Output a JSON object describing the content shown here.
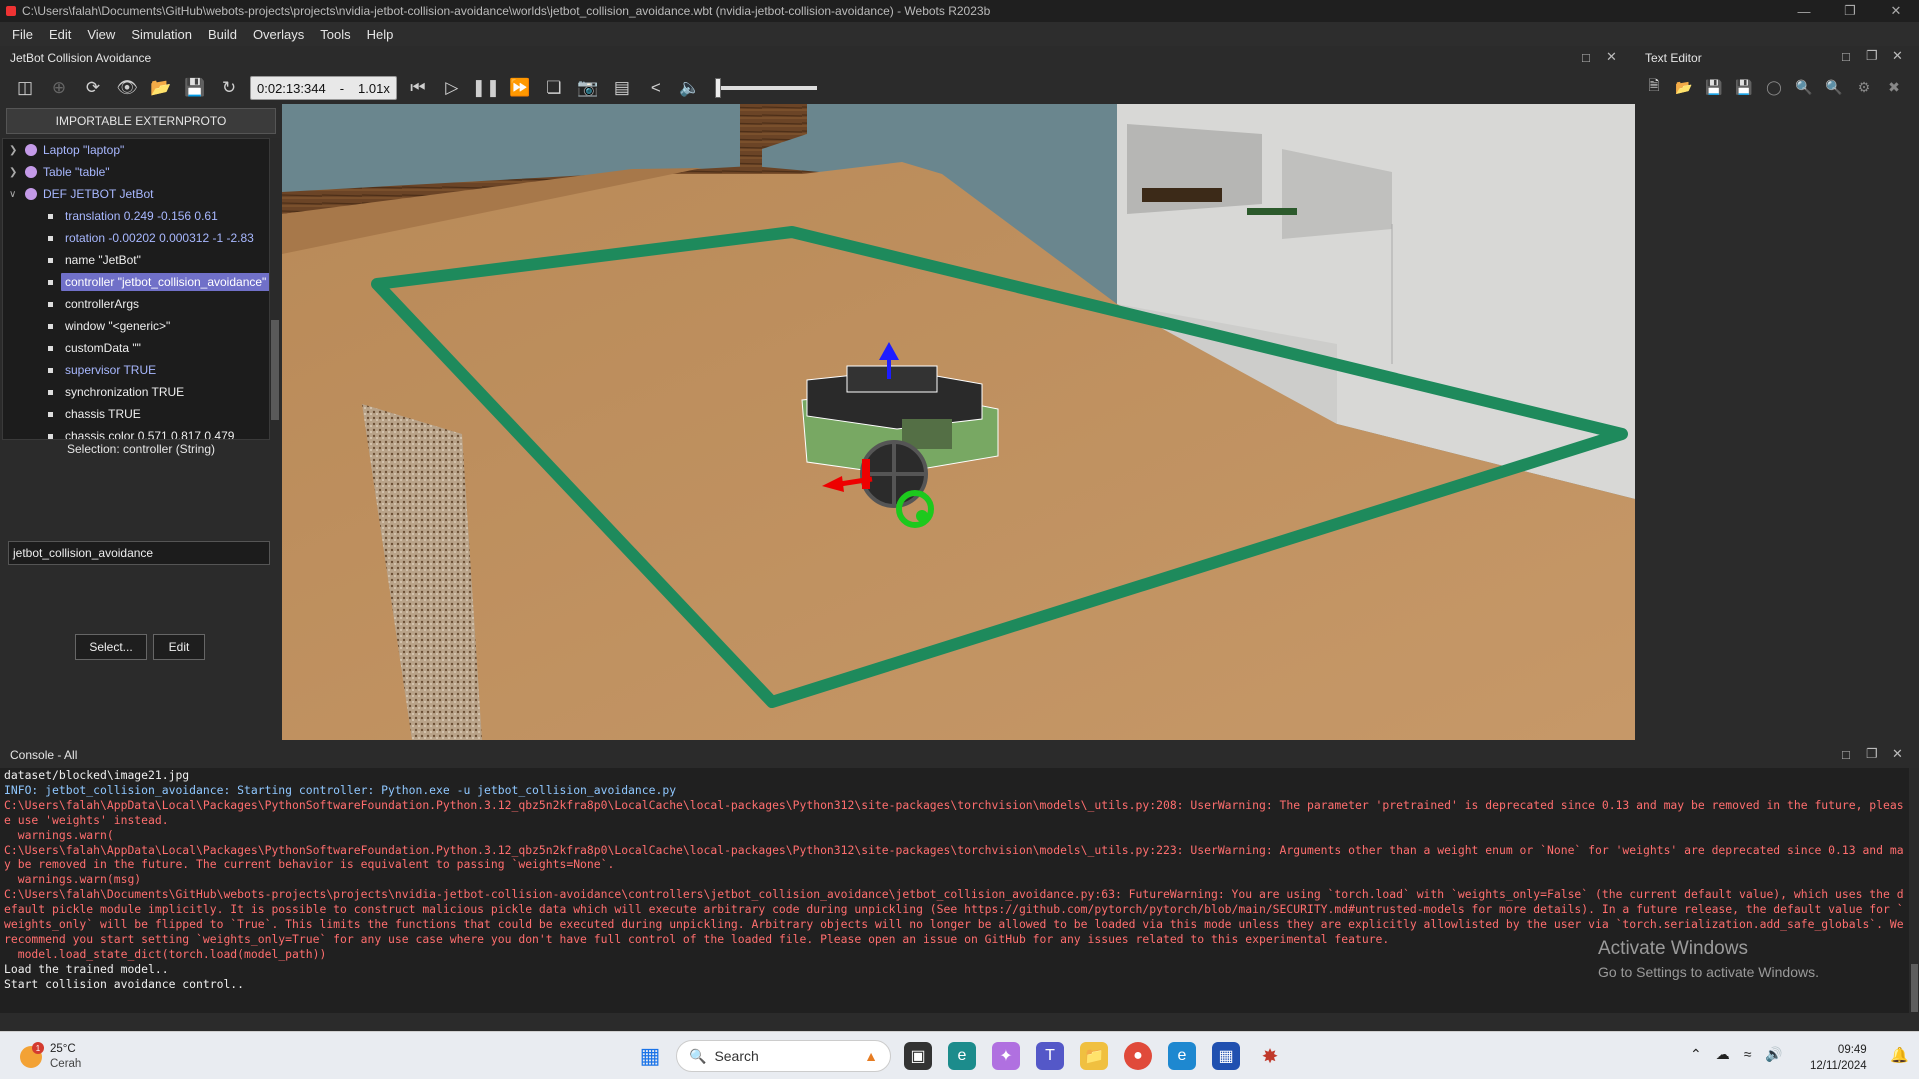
{
  "window": {
    "title": "C:\\Users\\falah\\Documents\\GitHub\\webots-projects\\projects\\nvidia-jetbot-collision-avoidance\\worlds\\jetbot_collision_avoidance.wbt (nvidia-jetbot-collision-avoidance) - Webots R2023b"
  },
  "menu": [
    "File",
    "Edit",
    "View",
    "Simulation",
    "Build",
    "Overlays",
    "Tools",
    "Help"
  ],
  "scene_panel": {
    "title": "JetBot Collision Avoidance",
    "import_button": "IMPORTABLE EXTERNPROTO",
    "tree": [
      {
        "label": "Laptop \"laptop\"",
        "type": "node"
      },
      {
        "label": "Table \"table\"",
        "type": "node"
      },
      {
        "label": "DEF JETBOT JetBot",
        "type": "node",
        "expanded": true
      },
      {
        "label": "translation 0.249 -0.156 0.61",
        "type": "field",
        "color": "blue"
      },
      {
        "label": "rotation -0.00202 0.000312 -1 -2.83",
        "type": "field",
        "color": "blue"
      },
      {
        "label": "name \"JetBot\"",
        "type": "field",
        "color": "white"
      },
      {
        "label": "controller \"jetbot_collision_avoidance\"",
        "type": "field",
        "color": "white",
        "selected": true
      },
      {
        "label": "controllerArgs",
        "type": "field",
        "color": "white"
      },
      {
        "label": "window \"<generic>\"",
        "type": "field",
        "color": "white"
      },
      {
        "label": "customData \"\"",
        "type": "field",
        "color": "white"
      },
      {
        "label": "supervisor TRUE",
        "type": "field",
        "color": "blue"
      },
      {
        "label": "synchronization TRUE",
        "type": "field",
        "color": "white"
      },
      {
        "label": "chassis TRUE",
        "type": "field",
        "color": "white"
      },
      {
        "label": "chassis color 0.571 0.817 0.479",
        "type": "field",
        "color": "white"
      }
    ],
    "selection_label": "Selection: controller (String)",
    "field_value": "jetbot_collision_avoidance",
    "select_button": "Select...",
    "edit_button": "Edit"
  },
  "toolbar": {
    "time": "0:02:13:344",
    "separator": "-",
    "speed": "1.01x"
  },
  "text_editor": {
    "title": "Text Editor"
  },
  "console": {
    "title": "Console - All",
    "lines": [
      {
        "text": "dataset/blocked\\image21.jpg",
        "color": "white"
      },
      {
        "text": "INFO: jetbot_collision_avoidance: Starting controller: Python.exe -u jetbot_collision_avoidance.py",
        "color": "blue"
      },
      {
        "text": "C:\\Users\\falah\\AppData\\Local\\Packages\\PythonSoftwareFoundation.Python.3.12_qbz5n2kfra8p0\\LocalCache\\local-packages\\Python312\\site-packages\\torchvision\\models\\_utils.py:208: UserWarning: The parameter 'pretrained' is deprecated since 0.13 and may be removed in the future, please use 'weights' instead.",
        "color": "red"
      },
      {
        "text": "  warnings.warn(",
        "color": "red"
      },
      {
        "text": "C:\\Users\\falah\\AppData\\Local\\Packages\\PythonSoftwareFoundation.Python.3.12_qbz5n2kfra8p0\\LocalCache\\local-packages\\Python312\\site-packages\\torchvision\\models\\_utils.py:223: UserWarning: Arguments other than a weight enum or `None` for 'weights' are deprecated since 0.13 and may be removed in the future. The current behavior is equivalent to passing `weights=None`.",
        "color": "red"
      },
      {
        "text": "  warnings.warn(msg)",
        "color": "red"
      },
      {
        "text": "C:\\Users\\falah\\Documents\\GitHub\\webots-projects\\projects\\nvidia-jetbot-collision-avoidance\\controllers\\jetbot_collision_avoidance\\jetbot_collision_avoidance.py:63: FutureWarning: You are using `torch.load` with `weights_only=False` (the current default value), which uses the default pickle module implicitly. It is possible to construct malicious pickle data which will execute arbitrary code during unpickling (See https://github.com/pytorch/pytorch/blob/main/SECURITY.md#untrusted-models for more details). In a future release, the default value for `weights_only` will be flipped to `True`. This limits the functions that could be executed during unpickling. Arbitrary objects will no longer be allowed to be loaded via this mode unless they are explicitly allowlisted by the user via `torch.serialization.add_safe_globals`. We recommend you start setting `weights_only=True` for any use case where you don't have full control of the loaded file. Please open an issue on GitHub for any issues related to this experimental feature.",
        "color": "red"
      },
      {
        "text": "  model.load_state_dict(torch.load(model_path))",
        "color": "red"
      },
      {
        "text": "Load the trained model..",
        "color": "white"
      },
      {
        "text": "Start collision avoidance control..",
        "color": "white"
      }
    ]
  },
  "watermark": {
    "line1": "Activate Windows",
    "line2": "Go to Settings to activate Windows."
  },
  "taskbar": {
    "temp": "25°C",
    "condition": "Cerah",
    "badge": "1",
    "search_placeholder": "Search",
    "time": "09:49",
    "date": "12/11/2024"
  }
}
